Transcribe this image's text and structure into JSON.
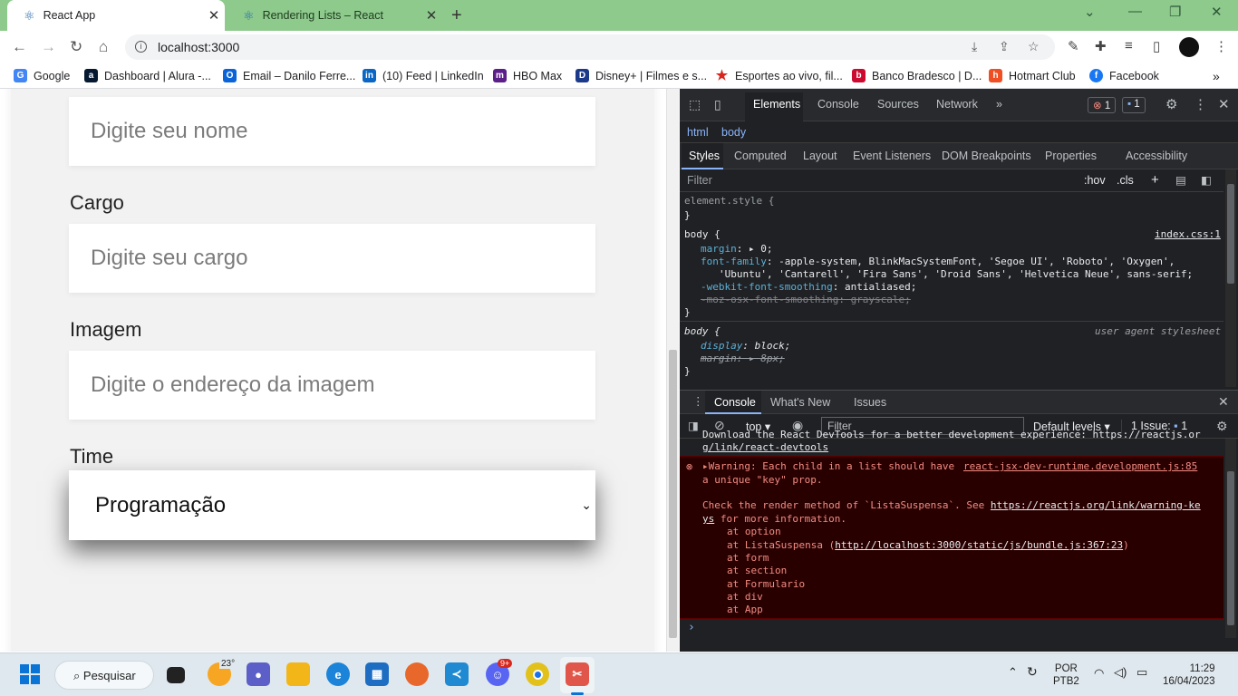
{
  "browser": {
    "tabs": [
      {
        "title": "React App",
        "active": true
      },
      {
        "title": "Rendering Lists – React",
        "active": false
      }
    ],
    "address": "localhost:3000",
    "bookmarks": [
      {
        "label": "Google",
        "color": "#4285f4",
        "glyph": "G"
      },
      {
        "label": "Dashboard | Alura -...",
        "color": "#051933",
        "glyph": "a"
      },
      {
        "label": "Email – Danilo Ferre...",
        "color": "#0a64d8",
        "glyph": "O"
      },
      {
        "label": "(10) Feed | LinkedIn",
        "color": "#0a66c2",
        "glyph": "in"
      },
      {
        "label": "HBO Max",
        "color": "#5c1f8a",
        "glyph": "m"
      },
      {
        "label": "Disney+ | Filmes e s...",
        "color": "#1b3a8a",
        "glyph": "D"
      },
      {
        "label": "Esportes ao vivo, fil...",
        "color": "#d8261c",
        "glyph": "★"
      },
      {
        "label": "Banco Bradesco | D...",
        "color": "#cc092f",
        "glyph": "b"
      },
      {
        "label": "Hotmart Club",
        "color": "#f04e23",
        "glyph": "h"
      },
      {
        "label": "Facebook",
        "color": "#1877f2",
        "glyph": "f"
      }
    ]
  },
  "form": {
    "nome_placeholder": "Digite seu nome",
    "cargo_label": "Cargo",
    "cargo_placeholder": "Digite seu cargo",
    "imagem_label": "Imagem",
    "imagem_placeholder": "Digite o endereço da imagem",
    "time_label": "Time",
    "time_selected": "Programação"
  },
  "devtools": {
    "main_tabs": [
      "Elements",
      "Console",
      "Sources",
      "Network"
    ],
    "error_count": "1",
    "issue_count": "1",
    "crumbs": [
      "html",
      "body"
    ],
    "sub_tabs": [
      "Styles",
      "Computed",
      "Layout",
      "Event Listeners",
      "DOM Breakpoints",
      "Properties",
      "Accessibility"
    ],
    "filter_placeholder": "Filter",
    "hov": ":hov",
    "cls": ".cls",
    "styles": {
      "element_style": "element.style {",
      "close": "}",
      "body_selector": "body {",
      "body_source": "index.css:1",
      "margin_prop": "margin",
      "margin_val": "0;",
      "font_family_prop": "font-family",
      "font_family_val_1": "-apple-system, BlinkMacSystemFont, 'Segoe UI', 'Roboto', 'Oxygen',",
      "font_family_val_2": "'Ubuntu', 'Cantarell', 'Fira Sans', 'Droid Sans', 'Helvetica Neue', sans-serif;",
      "smoothing_prop": "-webkit-font-smoothing",
      "smoothing_val": "antialiased;",
      "moz_line": "-moz-osx-font-smoothing: grayscale;",
      "ua_selector": "body {",
      "ua_source": "user agent stylesheet",
      "display_prop": "display",
      "display_val": "block;",
      "ua_margin_prop": "margin",
      "ua_margin_val": "8px;"
    },
    "drawer_tabs": [
      "Console",
      "What's New",
      "Issues"
    ],
    "console_toolbar": {
      "context": "top",
      "filter": "Filter",
      "levels": "Default levels",
      "issues": "1 Issue:",
      "issues_count": "1"
    },
    "console": {
      "prev_line_1": "Download the React DevTools for a better development experience: https://reactjs.or",
      "prev_line_2": "g/link/react-devtools",
      "warn_head": "Warning: Each child in a list should have",
      "warn_source": "react-jsx-dev-runtime.development.js:85",
      "warn_line2": "a unique \"key\" prop.",
      "check_1": "Check the render method of `ListaSuspensa`. See",
      "check_link": "https://reactjs.org/link/warning-ke",
      "check_link2": "ys",
      "check_2": "for more information.",
      "stack": [
        "at option",
        "at ListaSuspensa (",
        "at form",
        "at section",
        "at Formulario",
        "at div",
        "at App"
      ],
      "stack_link": "http://localhost:3000/static/js/bundle.js:367:23",
      "stack_close": ")"
    }
  },
  "taskbar": {
    "search_label": "Pesquisar",
    "weather": "23°",
    "lang_1": "POR",
    "lang_2": "PTB2",
    "time": "11:29",
    "date": "16/04/2023",
    "discord_badge": "9+"
  }
}
